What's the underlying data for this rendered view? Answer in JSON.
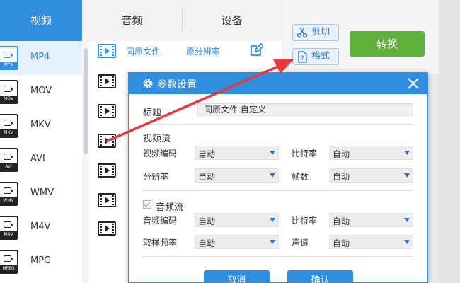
{
  "tabs": {
    "video": "视频",
    "audio": "音频",
    "device": "设备"
  },
  "formats": [
    {
      "name": "MP4",
      "badge": "MP4",
      "selected": true
    },
    {
      "name": "MOV",
      "badge": "MOV",
      "selected": false
    },
    {
      "name": "MKV",
      "badge": "MKV",
      "selected": false
    },
    {
      "name": "AVI",
      "badge": "AVI",
      "selected": false
    },
    {
      "name": "WMV",
      "badge": "WMV",
      "selected": false
    },
    {
      "name": "M4V",
      "badge": "M4V",
      "selected": false
    },
    {
      "name": "MPG",
      "badge": "MPEG",
      "selected": false
    }
  ],
  "presets": [
    {
      "name": "同原文件",
      "resolution": "原分辨率"
    },
    {
      "name": "",
      "resolution": ""
    },
    {
      "name": "",
      "resolution": ""
    },
    {
      "name": "",
      "resolution": ""
    },
    {
      "name": "",
      "resolution": ""
    },
    {
      "name": "",
      "resolution": ""
    },
    {
      "name": "",
      "resolution": ""
    },
    {
      "name": "",
      "resolution": ""
    }
  ],
  "toolbar": {
    "cut_label": "剪切",
    "format_label": "格式",
    "convert_label": "转换"
  },
  "dialog": {
    "title": "参数设置",
    "title_label": "标题",
    "title_value": "同原文件 自定义",
    "video_section": "视频流",
    "video_codec_label": "视频编码",
    "video_codec_value": "自动",
    "video_bitrate_label": "比特率",
    "video_bitrate_value": "自动",
    "resolution_label": "分辨率",
    "resolution_value": "自动",
    "fps_label": "帧数",
    "fps_value": "自动",
    "audio_section": "音频流",
    "audio_enabled": true,
    "audio_codec_label": "音频编码",
    "audio_codec_value": "自动",
    "audio_bitrate_label": "比特率",
    "audio_bitrate_value": "自动",
    "sample_rate_label": "取样频率",
    "sample_rate_value": "自动",
    "channel_label": "声道",
    "channel_value": "自动",
    "cancel_label": "取消",
    "ok_label": "确认"
  },
  "colors": {
    "accent": "#2f8ee0",
    "convert": "#5fb03c",
    "annotation_arrow": "#e8383d"
  }
}
